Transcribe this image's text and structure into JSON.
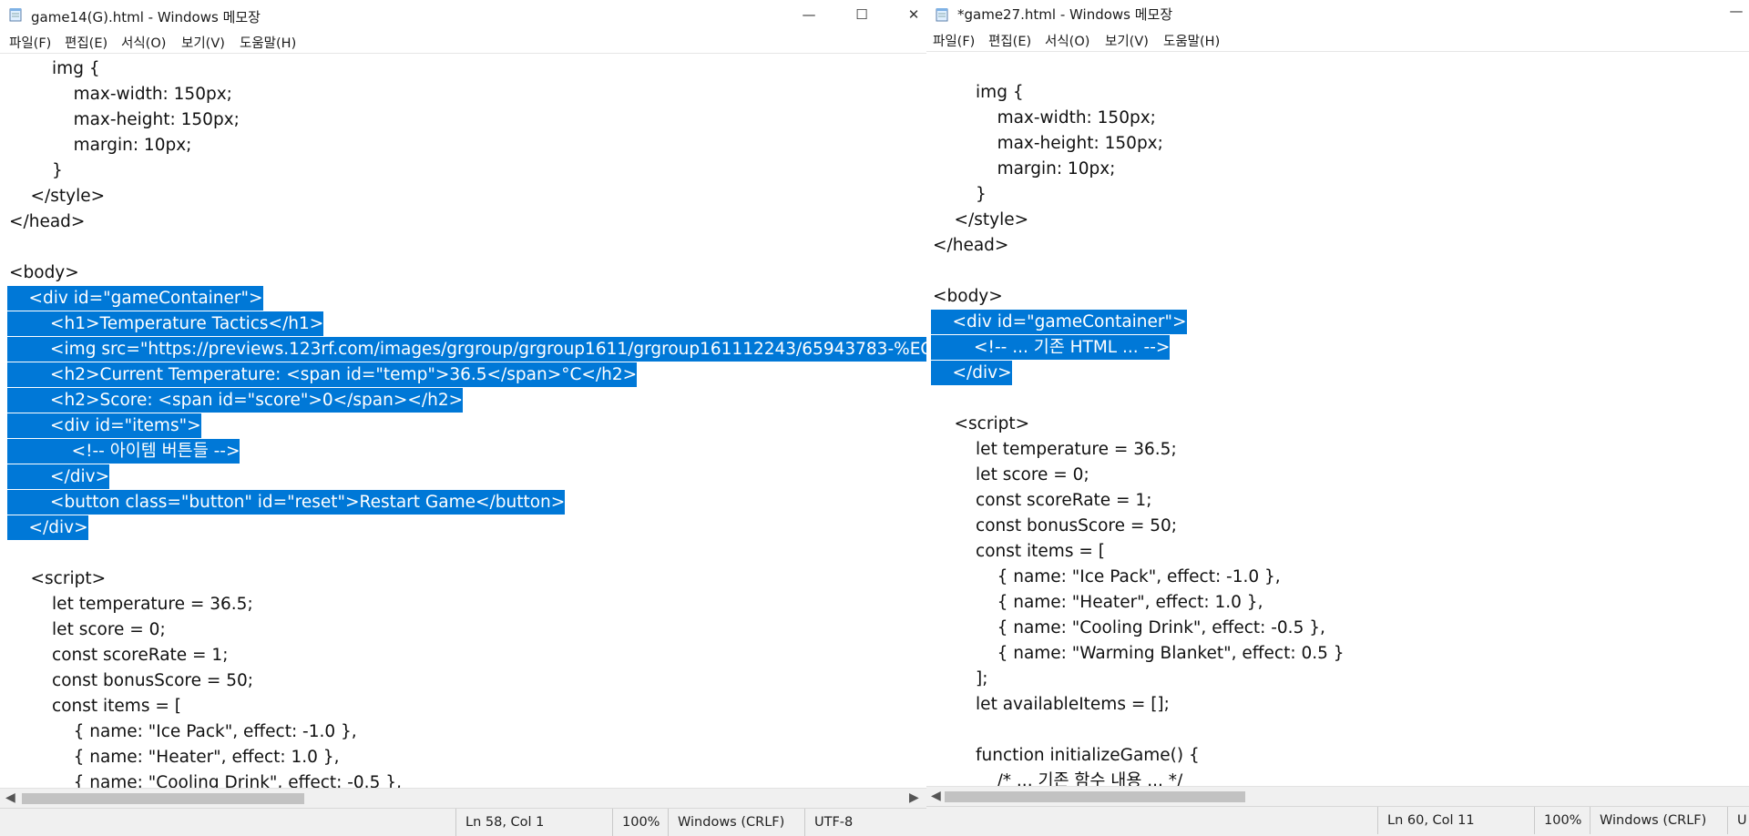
{
  "window1": {
    "title": "game14(G).html - Windows 메모장",
    "menu": [
      "파일(F)",
      "편집(E)",
      "서식(O)",
      "보기(V)",
      "도움말(H)"
    ],
    "lines": [
      "        img {",
      "            max-width: 150px;",
      "            max-height: 150px;",
      "            margin: 10px;",
      "        }",
      "    </style>",
      "</head>",
      "",
      "<body>",
      "    <div id=\"gameContainer\">",
      "        <h1>Temperature Tactics</h1>",
      "        <img src=\"https://previews.123rf.com/images/grgroup/grgroup1611/grgroup161112243/65943783-%EC",
      "        <h2>Current Temperature: <span id=\"temp\">36.5</span>°C</h2>",
      "        <h2>Score: <span id=\"score\">0</span></h2>",
      "        <div id=\"items\">",
      "            <!-- 아이템 버튼들 -->",
      "        </div>",
      "        <button class=\"button\" id=\"reset\">Restart Game</button>",
      "    </div>",
      "",
      "    <script>",
      "        let temperature = 36.5;",
      "        let score = 0;",
      "        const scoreRate = 1;",
      "        const bonusScore = 50;",
      "        const items = [",
      "            { name: \"Ice Pack\", effect: -1.0 },",
      "            { name: \"Heater\", effect: 1.0 },",
      "            { name: \"Cooling Drink\", effect: -0.5 },"
    ],
    "status": {
      "position": "Ln 58, Col 1",
      "zoom": "100%",
      "line_ending": "Windows (CRLF)",
      "encoding": "UTF-8"
    }
  },
  "window2": {
    "title": "*game27.html - Windows 메모장",
    "menu": [
      "파일(F)",
      "편집(E)",
      "서식(O)",
      "보기(V)",
      "도움말(H)"
    ],
    "lines": [
      "",
      "        img {",
      "            max-width: 150px;",
      "            max-height: 150px;",
      "            margin: 10px;",
      "        }",
      "    </style>",
      "</head>",
      "",
      "<body>",
      "    <div id=\"gameContainer\">",
      "        <!-- ... 기존 HTML ... -->",
      "    </div>",
      "",
      "    <script>",
      "        let temperature = 36.5;",
      "        let score = 0;",
      "        const scoreRate = 1;",
      "        const bonusScore = 50;",
      "        const items = [",
      "            { name: \"Ice Pack\", effect: -1.0 },",
      "            { name: \"Heater\", effect: 1.0 },",
      "            { name: \"Cooling Drink\", effect: -0.5 },",
      "            { name: \"Warming Blanket\", effect: 0.5 }",
      "        ];",
      "        let availableItems = [];",
      "",
      "        function initializeGame() {",
      "            /* ... 기존 함수 내용 ... */"
    ],
    "status": {
      "position": "Ln 60, Col 11",
      "zoom": "100%",
      "line_ending": "Windows (CRLF)",
      "encoding": "U"
    }
  },
  "colors": {
    "selection": "#0078d7",
    "text": "#111111",
    "statusbar": "#f0f0f0"
  },
  "icons": [
    "notepad-icon",
    "minimize-icon",
    "maximize-icon",
    "close-icon",
    "scroll-left-icon",
    "scroll-right-icon"
  ]
}
